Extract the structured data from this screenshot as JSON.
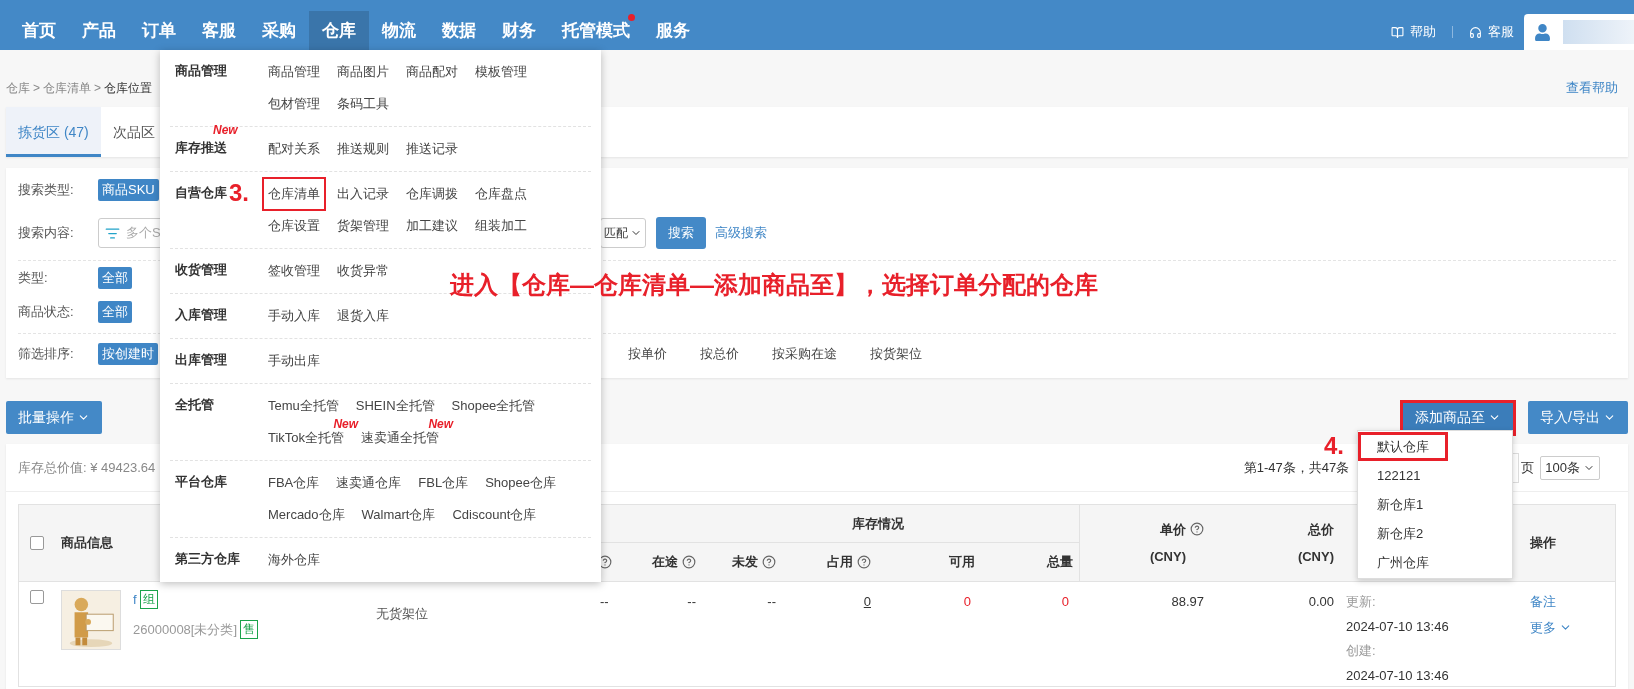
{
  "nav": {
    "items": [
      {
        "label": "首页",
        "selected": false,
        "dot": false
      },
      {
        "label": "产品",
        "selected": false,
        "dot": false
      },
      {
        "label": "订单",
        "selected": false,
        "dot": false
      },
      {
        "label": "客服",
        "selected": false,
        "dot": false
      },
      {
        "label": "采购",
        "selected": false,
        "dot": false
      },
      {
        "label": "仓库",
        "selected": true,
        "dot": false
      },
      {
        "label": "物流",
        "selected": false,
        "dot": false
      },
      {
        "label": "数据",
        "selected": false,
        "dot": false
      },
      {
        "label": "财务",
        "selected": false,
        "dot": false
      },
      {
        "label": "托管模式",
        "selected": false,
        "dot": true
      },
      {
        "label": "服务",
        "selected": false,
        "dot": false
      }
    ],
    "help": "帮助",
    "service": "客服"
  },
  "breadcrumb": [
    {
      "label": "仓库"
    },
    {
      "separator": ">",
      "label": "仓库清单"
    },
    {
      "separator": ">",
      "label": "仓库位置"
    }
  ],
  "help_link": "查看帮助",
  "tabs": [
    {
      "label": "拣货区 (47)",
      "selected": true
    },
    {
      "label": "次品区",
      "selected": false
    }
  ],
  "filters": {
    "search_type": {
      "label": "搜索类型:",
      "value": "商品SKU"
    },
    "search_content": {
      "label": "搜索内容:",
      "placeholder": "多个S",
      "match": "匹配",
      "button": "搜索",
      "advanced": "高级搜索"
    },
    "type": {
      "label": "类型:",
      "value": "全部"
    },
    "status": {
      "label": "商品状态:",
      "value": "全部"
    },
    "sort": {
      "label": "筛选排序:",
      "options": [
        {
          "label": "按创建时",
          "selected": true
        },
        {
          "label": "按单价",
          "selected": false
        },
        {
          "label": "按总价",
          "selected": false
        },
        {
          "label": "按采购在途",
          "selected": false
        },
        {
          "label": "按货架位",
          "selected": false
        }
      ]
    }
  },
  "actions": {
    "batch": "批量操作",
    "add_to": {
      "label": "添加商品至",
      "marked": true,
      "options": [
        {
          "label": "默认仓库",
          "marked": true
        },
        {
          "label": "122121",
          "marked": false
        },
        {
          "label": "新仓库1",
          "marked": false
        },
        {
          "label": "新仓库2",
          "marked": false
        },
        {
          "label": "广州仓库",
          "marked": false
        }
      ]
    },
    "import_export": "导入/导出"
  },
  "summary": "库存总价值: ¥ 49423.64",
  "pagination": {
    "range": "第1-47条，共47条",
    "page_suffix": "页",
    "page_size": "100条"
  },
  "table": {
    "header_checked": false,
    "product_column": "商品信息",
    "stock_group": "库存情况",
    "stock_columns": [
      {
        "kind": "plain",
        "help": true
      },
      {
        "label": "在途",
        "kind": "plain",
        "help": true
      },
      {
        "label": "未发",
        "kind": "plain",
        "help": true
      },
      {
        "label": "占用",
        "kind": "link",
        "help": true
      },
      {
        "label": "可用",
        "kind": "alert",
        "help": false
      },
      {
        "label": "总量",
        "kind": "alert",
        "help": false
      }
    ],
    "price_columns": [
      {
        "label": "单价",
        "unit": "(CNY)",
        "help": true
      },
      {
        "label": "总价",
        "unit": "(CNY)",
        "help": false
      }
    ],
    "action_column": "操作",
    "rows": [
      {
        "checked": false,
        "name": "f",
        "name_tag": "组",
        "sku": "26000008[未分类]",
        "sku_tag": "售",
        "shelf": "无货架位",
        "stock": [
          "--",
          "--",
          "--",
          "0",
          "0",
          "0"
        ],
        "prices": [
          "88.97",
          "0.00"
        ],
        "times": [
          {
            "label": "更新:",
            "value": "2024-07-10 13:46"
          },
          {
            "label": "创建:",
            "value": "2024-07-10 13:46"
          }
        ],
        "actions": [
          {
            "label": "备注",
            "caret": false
          },
          {
            "label": "更多",
            "caret": true
          }
        ]
      }
    ]
  },
  "menu": {
    "sections": [
      {
        "title": "商品管理",
        "items": [
          {
            "label": "商品管理",
            "marked": false
          },
          {
            "label": "商品图片",
            "marked": false
          },
          {
            "label": "商品配对",
            "marked": false
          },
          {
            "label": "模板管理",
            "marked": false
          },
          {
            "label": "包材管理",
            "marked": false
          },
          {
            "label": "条码工具",
            "marked": false
          }
        ]
      },
      {
        "title": "库存推送",
        "badge": "New",
        "items": [
          {
            "label": "配对关系",
            "marked": false
          },
          {
            "label": "推送规则",
            "marked": false
          },
          {
            "label": "推送记录",
            "marked": false
          }
        ]
      },
      {
        "title": "自营仓库",
        "step": "3.",
        "items": [
          {
            "label": "仓库清单",
            "marked": true
          },
          {
            "label": "出入记录",
            "marked": false
          },
          {
            "label": "仓库调拨",
            "marked": false
          },
          {
            "label": "仓库盘点",
            "marked": false
          },
          {
            "label": "仓库设置",
            "marked": false
          },
          {
            "label": "货架管理",
            "marked": false
          },
          {
            "label": "加工建议",
            "marked": false
          },
          {
            "label": "组装加工",
            "marked": false
          }
        ]
      },
      {
        "title": "收货管理",
        "items": [
          {
            "label": "签收管理",
            "marked": false
          },
          {
            "label": "收货异常",
            "marked": false
          }
        ]
      },
      {
        "title": "入库管理",
        "items": [
          {
            "label": "手动入库",
            "marked": false
          },
          {
            "label": "退货入库",
            "marked": false
          }
        ]
      },
      {
        "title": "出库管理",
        "items": [
          {
            "label": "手动出库",
            "marked": false
          }
        ]
      },
      {
        "title": "全托管",
        "items": [
          {
            "label": "Temu全托管",
            "marked": false
          },
          {
            "label": "SHEIN全托管",
            "marked": false
          },
          {
            "label": "Shopee全托管",
            "marked": false
          },
          {
            "label": "TikTok全托管",
            "marked": false,
            "badge": "New"
          },
          {
            "label": "速卖通全托管",
            "marked": false,
            "badge": "New"
          }
        ]
      },
      {
        "title": "平台仓库",
        "items": [
          {
            "label": "FBA仓库",
            "marked": false
          },
          {
            "label": "速卖通仓库",
            "marked": false
          },
          {
            "label": "FBL仓库",
            "marked": false
          },
          {
            "label": "Shopee仓库",
            "marked": false
          },
          {
            "label": "Mercado仓库",
            "marked": false
          },
          {
            "label": "Walmart仓库",
            "marked": false
          },
          {
            "label": "Cdiscount仓库",
            "marked": false
          }
        ]
      },
      {
        "title": "第三方仓库",
        "items": [
          {
            "label": "海外仓库",
            "marked": false
          }
        ]
      }
    ]
  },
  "annotations": {
    "dropdown_step": "4.",
    "instruction": "进入【仓库—仓库清单—添加商品至】，选择订单分配的仓库"
  }
}
